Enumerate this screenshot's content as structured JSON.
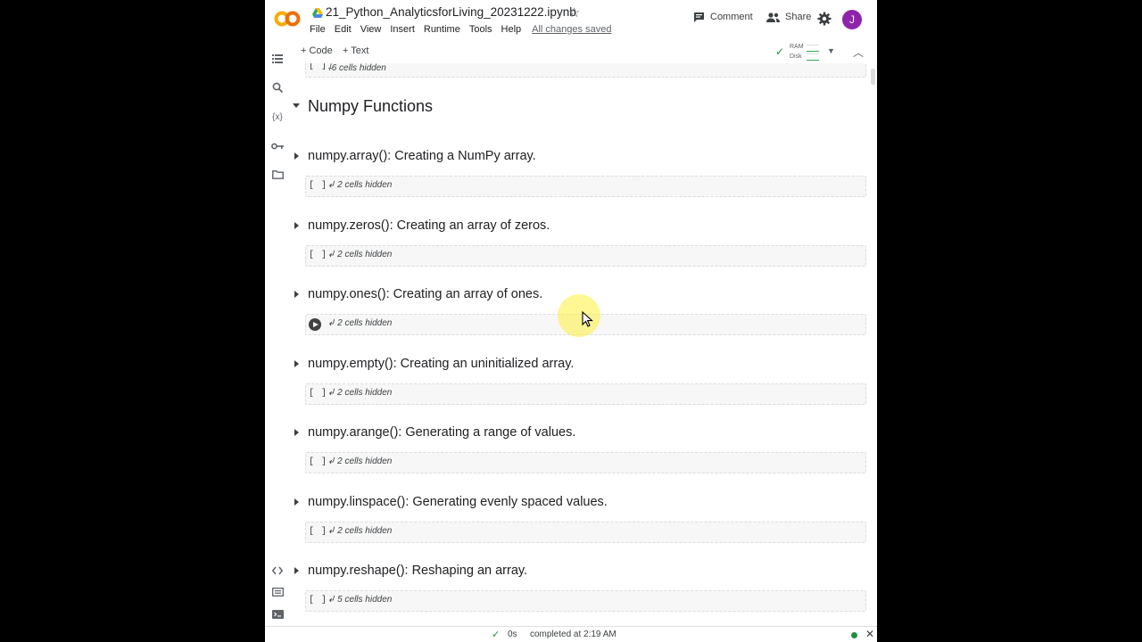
{
  "header": {
    "logo_text": "CO",
    "doc_title": "21_Python_AnalyticsforLiving_20231222.ipynb",
    "menu": [
      "File",
      "Edit",
      "View",
      "Insert",
      "Runtime",
      "Tools",
      "Help"
    ],
    "save_status": "All changes saved",
    "comment_label": "Comment",
    "share_label": "Share",
    "avatar_letter": "J",
    "avatar_color": "#8e24aa"
  },
  "toolbar": {
    "code_label": "+ Code",
    "text_label": "+ Text",
    "ram_label": "RAM",
    "disk_label": "Disk"
  },
  "notebook": {
    "top_hidden": "6 cells hidden",
    "section_title": "Numpy Functions",
    "items": [
      {
        "heading": "numpy.array(): Creating a NumPy array.",
        "hidden": "2 cells hidden"
      },
      {
        "heading": "numpy.zeros(): Creating an array of zeros.",
        "hidden": "2 cells hidden"
      },
      {
        "heading": "numpy.ones(): Creating an array of ones.",
        "hidden": "2 cells hidden"
      },
      {
        "heading": "numpy.empty(): Creating an uninitialized array.",
        "hidden": "2 cells hidden"
      },
      {
        "heading": "numpy.arange(): Generating a range of values.",
        "hidden": "2 cells hidden"
      },
      {
        "heading": "numpy.linspace(): Generating evenly spaced values.",
        "hidden": "2 cells hidden"
      },
      {
        "heading": "numpy.reshape(): Reshaping an array.",
        "hidden": "5 cells hidden"
      }
    ],
    "bracket": "[ ]"
  },
  "status": {
    "duration": "0s",
    "completed": "completed at 2:19 AM",
    "connected_color": "#1e8e3e"
  }
}
